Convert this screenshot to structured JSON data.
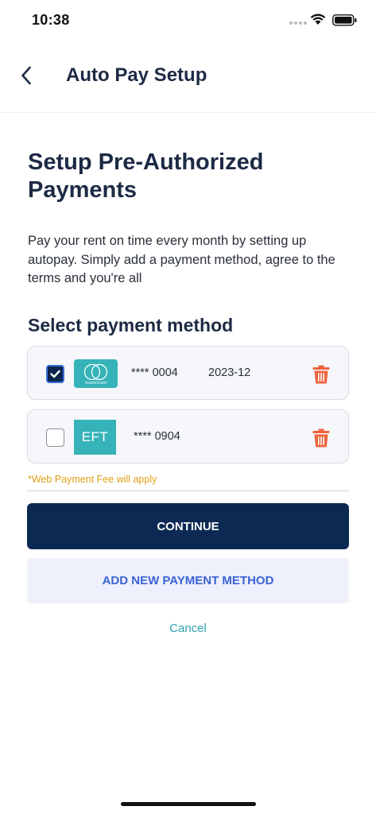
{
  "status_bar": {
    "time": "10:38"
  },
  "header": {
    "title": "Auto Pay Setup",
    "back_icon": "chevron-left-icon"
  },
  "main": {
    "heading": "Setup Pre-Authorized Payments",
    "description": "Pay your rent on time every month by setting up autopay. Simply add a payment method, agree to the terms and you're all",
    "section_title": "Select payment method",
    "payment_methods": [
      {
        "type": "mastercard",
        "logo_text": "mastercard",
        "number": "**** 0004",
        "expiry": "2023-12",
        "checked": true
      },
      {
        "type": "eft",
        "logo_text": "EFT",
        "number": "**** 0904",
        "expiry": "",
        "checked": false
      }
    ],
    "fee_note": "*Web Payment Fee will apply",
    "continue_label": "CONTINUE",
    "add_label": "ADD NEW PAYMENT METHOD",
    "cancel_label": "Cancel"
  },
  "colors": {
    "primary": "#0c2954",
    "accent_blue": "#3b63d6",
    "teal": "#36b3b8",
    "delete": "#f0633d",
    "warning": "#e0a017"
  }
}
